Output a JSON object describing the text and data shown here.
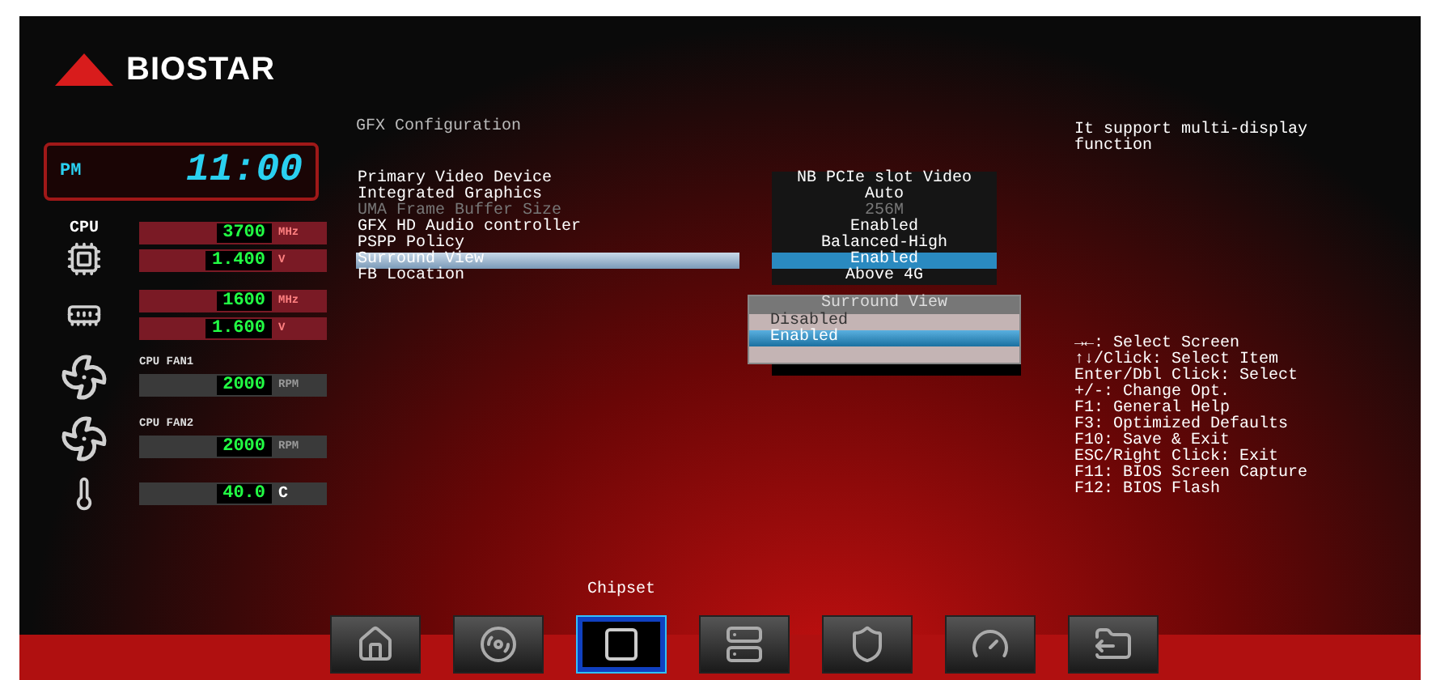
{
  "logo": {
    "text": "BIOSTAR"
  },
  "clock": {
    "period": "PM",
    "time": "11:00"
  },
  "monitors": [
    {
      "kind": "cpu",
      "label": "CPU",
      "readings": [
        {
          "value": "3700",
          "unit": "MHz"
        },
        {
          "value": "1.400",
          "unit": "V"
        }
      ]
    },
    {
      "kind": "memory",
      "readings": [
        {
          "value": "1600",
          "unit": "MHz"
        },
        {
          "value": "1.600",
          "unit": "V"
        }
      ]
    },
    {
      "kind": "fan",
      "label": "CPU FAN1",
      "readings": [
        {
          "value": "2000",
          "unit": "RPM"
        }
      ]
    },
    {
      "kind": "fan",
      "label": "CPU FAN2",
      "readings": [
        {
          "value": "2000",
          "unit": "RPM"
        }
      ]
    },
    {
      "kind": "temperature",
      "readings": [
        {
          "value": "40.0",
          "unit": "C"
        }
      ]
    }
  ],
  "section_title": "GFX Configuration",
  "settings": [
    {
      "label": "Primary Video Device",
      "value": "NB PCIe slot Video",
      "disabled": false,
      "selected": false
    },
    {
      "label": "Integrated Graphics",
      "value": "Auto",
      "disabled": false,
      "selected": false
    },
    {
      "label": "UMA Frame Buffer Size",
      "value": "256M",
      "disabled": true,
      "selected": false
    },
    {
      "label": "GFX HD Audio controller",
      "value": "Enabled",
      "disabled": false,
      "selected": false
    },
    {
      "label": "PSPP Policy",
      "value": "Balanced-High",
      "disabled": false,
      "selected": false
    },
    {
      "label": "Surround View",
      "value": "Enabled",
      "disabled": false,
      "selected": true
    },
    {
      "label": "FB Location",
      "value": "Above 4G",
      "disabled": false,
      "selected": false
    }
  ],
  "popup": {
    "title": "Surround View",
    "options": [
      {
        "label": "Disabled",
        "selected": false
      },
      {
        "label": "Enabled",
        "selected": true
      }
    ]
  },
  "help_text": "It support multi-display function",
  "key_help": [
    "→←: Select Screen",
    "↑↓/Click: Select Item",
    "Enter/Dbl Click: Select",
    "+/-: Change Opt.",
    "F1: General Help",
    "F3: Optimized Defaults",
    "F10: Save & Exit",
    "ESC/Right Click: Exit",
    "F11: BIOS Screen Capture",
    "F12: BIOS Flash"
  ],
  "tabs": [
    {
      "kind": "home",
      "selected": false
    },
    {
      "kind": "disc",
      "selected": false
    },
    {
      "kind": "chip",
      "selected": true,
      "label": "Chipset"
    },
    {
      "kind": "drive",
      "selected": false
    },
    {
      "kind": "shield",
      "selected": false
    },
    {
      "kind": "gauge",
      "selected": false
    },
    {
      "kind": "folder",
      "selected": false
    }
  ]
}
